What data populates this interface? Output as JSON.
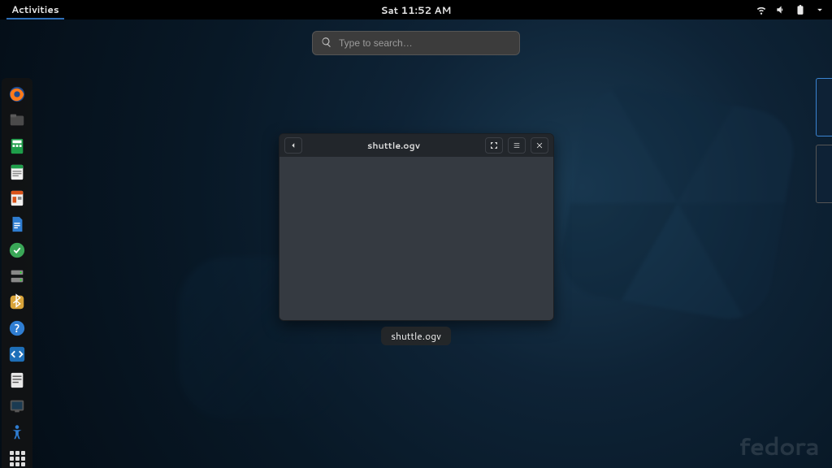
{
  "topbar": {
    "activities_label": "Activities",
    "clock": "Sat 11:52 AM"
  },
  "search": {
    "placeholder": "Type to search…"
  },
  "dash": {
    "items": [
      {
        "name": "firefox-icon"
      },
      {
        "name": "files-icon"
      },
      {
        "name": "calc-icon"
      },
      {
        "name": "writer-icon"
      },
      {
        "name": "impress-icon"
      },
      {
        "name": "document-icon"
      },
      {
        "name": "software-icon"
      },
      {
        "name": "disks-icon"
      },
      {
        "name": "bluetooth-icon"
      },
      {
        "name": "help-icon"
      },
      {
        "name": "code-icon"
      },
      {
        "name": "text-icon"
      },
      {
        "name": "screenshot-icon"
      },
      {
        "name": "accessibility-icon"
      }
    ]
  },
  "window": {
    "title": "shuttle.ogv",
    "label": "shuttle.ogv"
  },
  "brand": "fedora"
}
